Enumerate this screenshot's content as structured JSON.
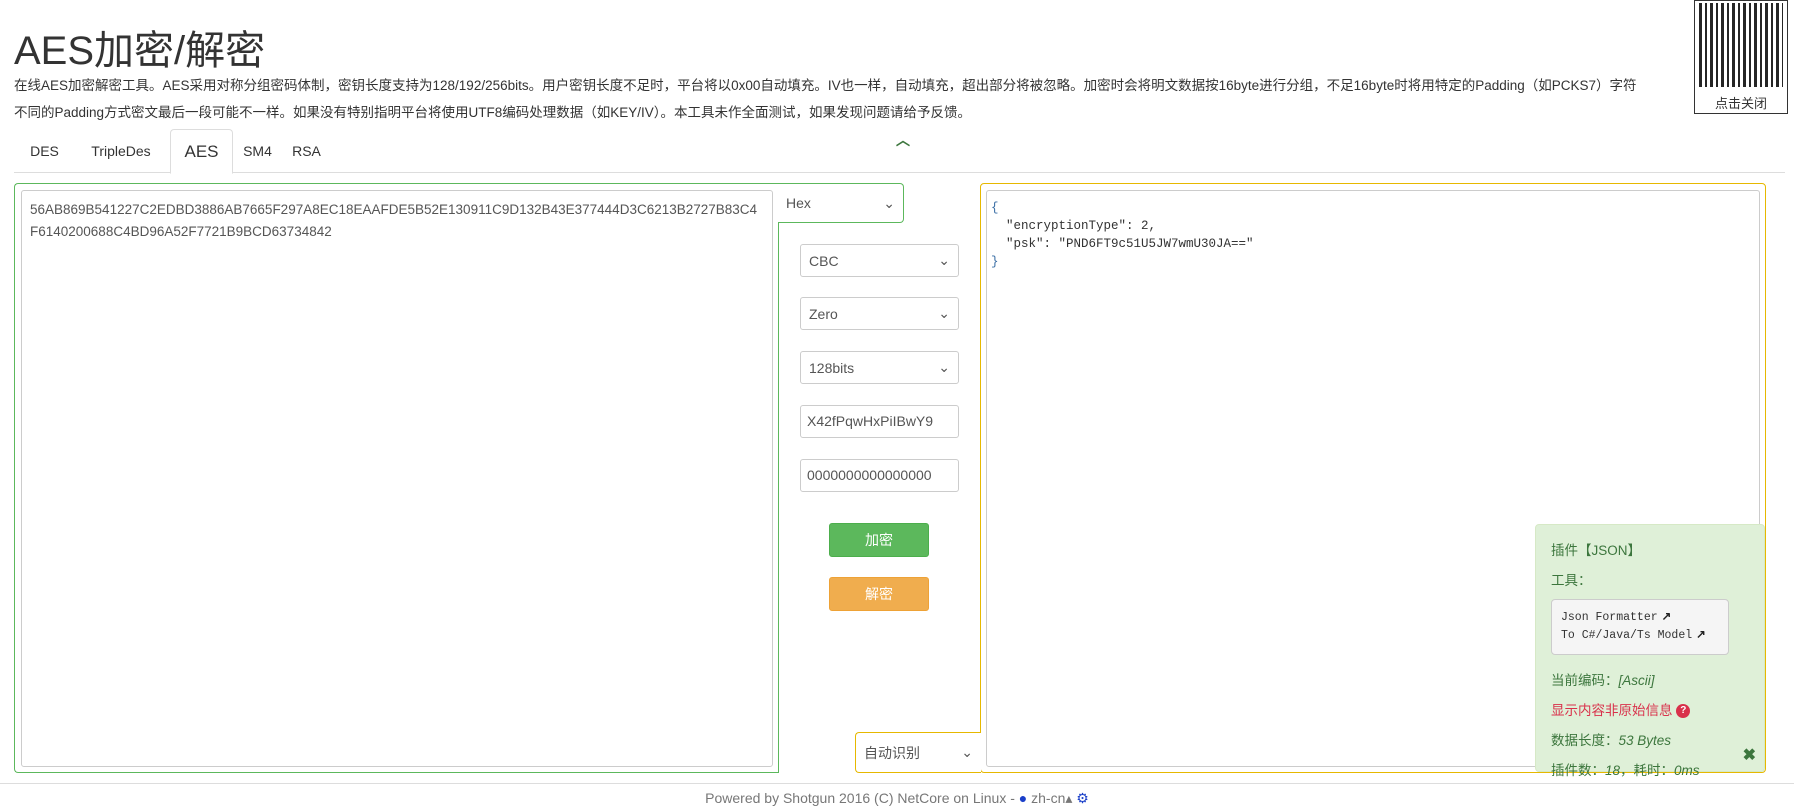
{
  "title": "AES加密/解密",
  "description": [
    "在线AES加密解密工具。AES采用对称分组密码体制，密钥长度支持为128/192/256bits。用户密钥长度不足时，平台将以0x00自动填充。IV也一样，自动填充，超出部分将被忽略。加密时会将明文数据按16byte进行分组，不足16byte时将用特定的Padding（如PCKS7）字符",
    "不同的Padding方式密文最后一段可能不一样。如果没有特别指明平台将使用UTF8编码处理数据（如KEY/IV）。本工具未作全面测试，如果发现问题请给予反馈。"
  ],
  "tabs": [
    "DES",
    "TripleDes",
    "AES",
    "SM4",
    "RSA"
  ],
  "active_tab": "AES",
  "input": {
    "value": "56AB869B541227C2EDBD3886AB7665F297A8EC18EAAFDE5B52E130911C9D132B43E377444D3C6213B2727B83C4F6140200688C4BD96A52F7721B9BCD63734842",
    "format": "Hex"
  },
  "controls": {
    "mode": "CBC",
    "padding": "Zero",
    "key_size": "128bits",
    "key": "X42fPqwHxPiIBwY9",
    "iv": "0000000000000000",
    "encrypt_label": "加密",
    "decrypt_label": "解密"
  },
  "output": {
    "lines": [
      "{",
      "  \"encryptionType\": 2,",
      "  \"psk\": \"PND6FT9c51U5JW7wmU30JA==\"",
      "}"
    ],
    "format": "自动识别"
  },
  "plugin": {
    "title": "插件【JSON】",
    "tools_label": "工具：",
    "tools": [
      "Json Formatter",
      "To C#/Java/Ts Model"
    ],
    "encoding_label": "当前编码：",
    "encoding_value": "[Ascii]",
    "warning": "显示内容非原始信息",
    "length_label": "数据长度：",
    "length_value": "53 Bytes",
    "count_label": "插件数：",
    "count_value": "18",
    "time_label": "，耗时：",
    "time_value": "0ms"
  },
  "qr": {
    "label": "点击关闭"
  },
  "footer": {
    "text": "Powered by Shotgun 2016 (C) NetCore on Linux - ",
    "lang": "zh-cn"
  },
  "colors": {
    "green": "#5cb85c",
    "orange": "#f0ad4e",
    "yellow_border": "#e6b800",
    "panel_bg": "#dff0d8"
  }
}
